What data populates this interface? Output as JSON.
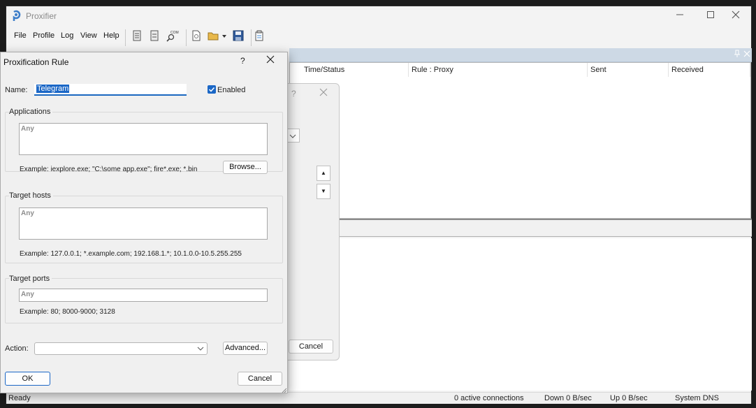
{
  "app": {
    "title": "Proxifier",
    "window_controls": [
      "minimize",
      "maximize",
      "close"
    ]
  },
  "menu": {
    "items": [
      "File",
      "Profile",
      "Log",
      "View",
      "Help"
    ]
  },
  "toolbar": {
    "icons": [
      "connections-icon",
      "traffic-icon",
      "dns-icon",
      "new-profile-icon",
      "open-profile-icon",
      "save-profile-icon",
      "clipboard-icon"
    ],
    "dns_icon_caption": "COM"
  },
  "connections": {
    "columns": [
      "Time/Status",
      "Rule : Proxy",
      "Sent",
      "Received"
    ]
  },
  "statusbar": {
    "ready": "Ready",
    "active_connections": "0 active connections",
    "down": "Down 0 B/sec",
    "up": "Up 0 B/sec",
    "dns": "System DNS"
  },
  "bg_dialog": {
    "help": "?",
    "cancel_label": "Cancel"
  },
  "rule_dialog": {
    "title": "Proxification Rule",
    "help": "?",
    "name_label": "Name:",
    "name_first_char": "T",
    "name_rest": "elegram",
    "enabled_label": "Enabled",
    "enabled_checked": true,
    "applications": {
      "title": "Applications",
      "value": "Any",
      "example": "Example: iexplore.exe; \"C:\\some app.exe\"; fire*.exe; *.bin",
      "browse_label": "Browse..."
    },
    "target_hosts": {
      "title": "Target hosts",
      "value": "Any",
      "example": "Example: 127.0.0.1; *.example.com; 192.168.1.*; 10.1.0.0-10.5.255.255"
    },
    "target_ports": {
      "title": "Target ports",
      "value": "Any",
      "example": "Example: 80; 8000-9000; 3128"
    },
    "action_label": "Action:",
    "action_value": "",
    "advanced_label": "Advanced...",
    "ok_label": "OK",
    "cancel_label": "Cancel"
  },
  "colors": {
    "accent": "#1b67c6",
    "header_bg": "#cdd9e5"
  }
}
